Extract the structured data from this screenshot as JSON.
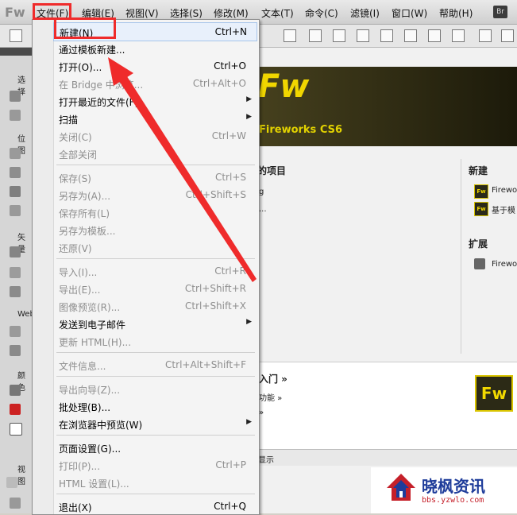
{
  "app": {
    "logo": "Fw",
    "bridge_badge": "Br"
  },
  "menubar": {
    "items": [
      "文件(F)",
      "编辑(E)",
      "视图(V)",
      "选择(S)",
      "修改(M)",
      "文本(T)",
      "命令(C)",
      "滤镜(I)",
      "窗口(W)",
      "帮助(H)"
    ]
  },
  "tools_panel": {
    "labels": [
      "选择",
      "位图",
      "矢量",
      "Web",
      "颜色",
      "视图"
    ]
  },
  "start_page": {
    "banner_logo": "Fw",
    "banner_title": "Fireworks CS6",
    "recent_title": "的项目",
    "recent_items": [
      "g",
      "..."
    ],
    "new_title": "新建",
    "new_items": [
      "Firewo",
      "基于模"
    ],
    "extend_title": "扩展",
    "extend_items": [
      "Firewo"
    ],
    "getting_started": "入门 »",
    "new_features": "功能 »",
    "more": "»",
    "big_logo": "Fw",
    "status_text": "显示"
  },
  "file_menu": {
    "items": [
      {
        "label": "新建(N)",
        "shortcut": "Ctrl+N",
        "disabled": false
      },
      {
        "label": "通过模板新建...",
        "shortcut": "",
        "disabled": false
      },
      {
        "label": "打开(O)...",
        "shortcut": "Ctrl+O",
        "disabled": false
      },
      {
        "label": "在 Bridge 中浏览...",
        "shortcut": "Ctrl+Alt+O",
        "disabled": true
      },
      {
        "label": "打开最近的文件(F)",
        "shortcut": "",
        "disabled": false,
        "submenu": true
      },
      {
        "label": "扫描",
        "shortcut": "",
        "disabled": false,
        "submenu": true
      },
      {
        "label": "关闭(C)",
        "shortcut": "Ctrl+W",
        "disabled": true
      },
      {
        "label": "全部关闭",
        "shortcut": "",
        "disabled": true
      },
      {
        "label": "保存(S)",
        "shortcut": "Ctrl+S",
        "disabled": true
      },
      {
        "label": "另存为(A)...",
        "shortcut": "Ctrl+Shift+S",
        "disabled": true
      },
      {
        "label": "保存所有(L)",
        "shortcut": "",
        "disabled": true
      },
      {
        "label": "另存为模板...",
        "shortcut": "",
        "disabled": true
      },
      {
        "label": "还原(V)",
        "shortcut": "",
        "disabled": true
      },
      {
        "label": "导入(I)...",
        "shortcut": "Ctrl+R",
        "disabled": true
      },
      {
        "label": "导出(E)...",
        "shortcut": "Ctrl+Shift+R",
        "disabled": true
      },
      {
        "label": "图像预览(R)...",
        "shortcut": "Ctrl+Shift+X",
        "disabled": true
      },
      {
        "label": "发送到电子邮件",
        "shortcut": "",
        "disabled": false,
        "submenu": true
      },
      {
        "label": "更新 HTML(H)...",
        "shortcut": "",
        "disabled": true
      },
      {
        "label": "文件信息...",
        "shortcut": "Ctrl+Alt+Shift+F",
        "disabled": true
      },
      {
        "label": "导出向导(Z)...",
        "shortcut": "",
        "disabled": true
      },
      {
        "label": "批处理(B)...",
        "shortcut": "",
        "disabled": false
      },
      {
        "label": "在浏览器中预览(W)",
        "shortcut": "",
        "disabled": false,
        "submenu": true
      },
      {
        "label": "页面设置(G)...",
        "shortcut": "",
        "disabled": false
      },
      {
        "label": "打印(P)...",
        "shortcut": "Ctrl+P",
        "disabled": true
      },
      {
        "label": "HTML 设置(L)...",
        "shortcut": "",
        "disabled": true
      },
      {
        "label": "退出(X)",
        "shortcut": "Ctrl+Q",
        "disabled": false
      }
    ]
  },
  "watermark": {
    "title": "晓枫资讯",
    "url": "bbs.yzwlo.com"
  },
  "colors": {
    "accent": "#f1d600",
    "annotation": "#ef2b2b",
    "watermark_blue": "#1e3c9a"
  }
}
